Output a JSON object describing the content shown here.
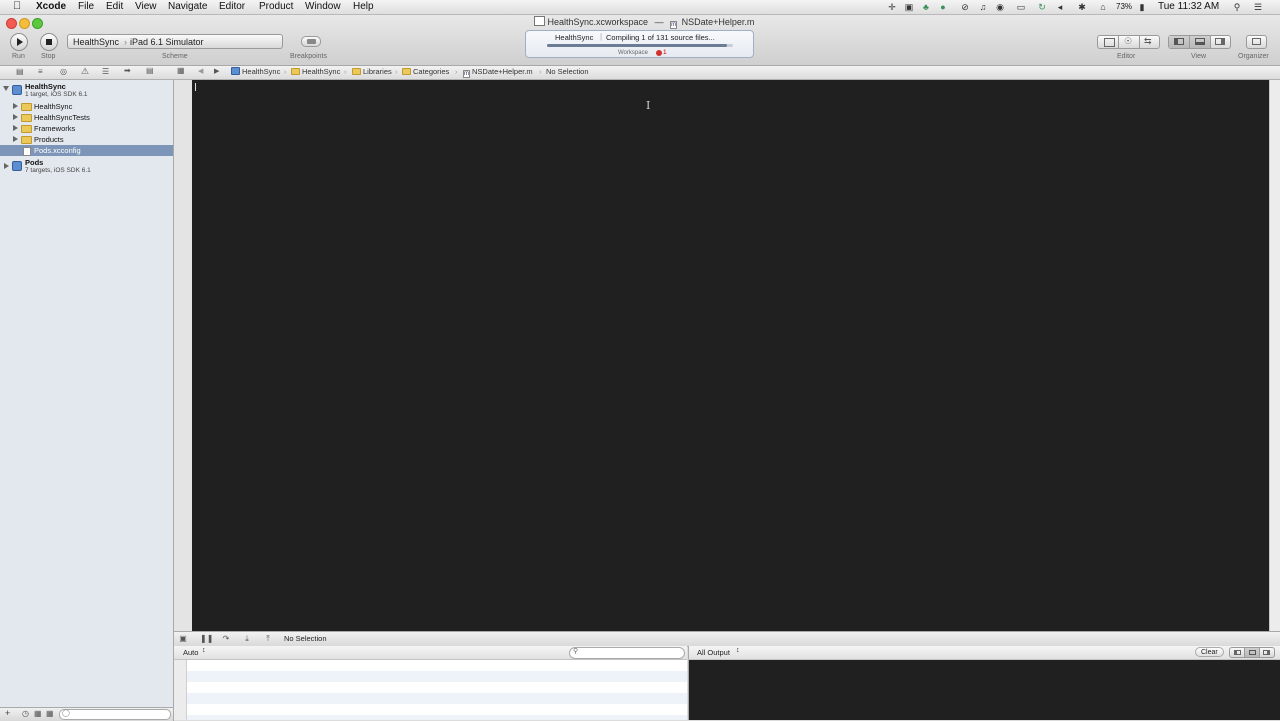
{
  "menubar": {
    "app": "Xcode",
    "items": [
      "File",
      "Edit",
      "View",
      "Navigate",
      "Editor",
      "Product",
      "Window",
      "Help"
    ],
    "battery": "73%",
    "clock": "Tue 11:32 AM"
  },
  "window": {
    "title_workspace": "HealthSync.xcworkspace",
    "title_sep": "—",
    "title_file": "NSDate+Helper.m"
  },
  "toolbar": {
    "run_label": "Run",
    "stop_label": "Stop",
    "scheme_label": "Scheme",
    "scheme_target": "HealthSync",
    "scheme_destination": "iPad 6.1 Simulator",
    "breakpoints_label": "Breakpoints",
    "editor_label": "Editor",
    "view_label": "View",
    "organizer_label": "Organizer"
  },
  "activity": {
    "project": "HealthSync",
    "status": "Compiling 1 of 131 source files...",
    "progress": 0.97,
    "workspace_label": "Workspace",
    "error_count": "1"
  },
  "pathbar": {
    "crumbs": [
      "HealthSync",
      "HealthSync",
      "Libraries",
      "Categories",
      "NSDate+Helper.m",
      "No Selection"
    ]
  },
  "navigator": {
    "project": {
      "name": "HealthSync",
      "subtitle": "1 target, iOS SDK 6.1"
    },
    "groups": [
      "HealthSync",
      "HealthSyncTests",
      "Frameworks",
      "Products"
    ],
    "selected_file": "Pods.xcconfig",
    "pods": {
      "name": "Pods",
      "subtitle": "7 targets, iOS SDK 6.1"
    }
  },
  "debug": {
    "selection": "No Selection",
    "variables_scope": "Auto",
    "output_scope": "All Output",
    "clear_label": "Clear"
  },
  "colors": {
    "editor_bg": "#202020",
    "selection": "#7c95b8",
    "error": "#d32f2f"
  }
}
